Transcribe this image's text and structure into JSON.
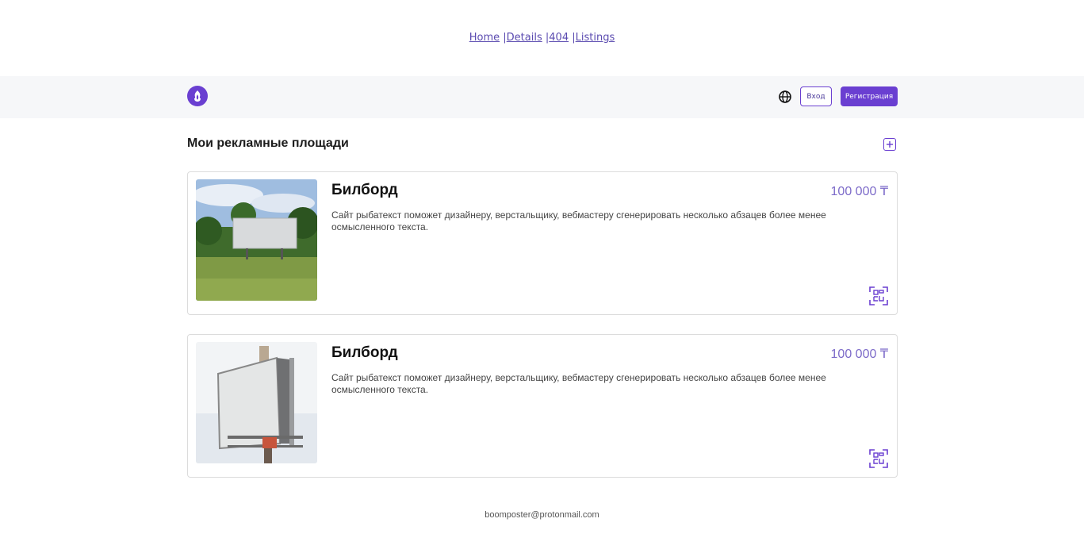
{
  "top_links": {
    "home": "Home",
    "details": "Details",
    "not_found": "404",
    "listings": "Listings",
    "separator": "|"
  },
  "header": {
    "logo_icon": "flame-icon",
    "language_icon": "globe-icon",
    "login_label": "Вход",
    "register_label": "Регистрация",
    "accent_color": "#6a3fd1"
  },
  "page": {
    "title": "Мои рекламные площади",
    "add_icon": "plus-square-icon"
  },
  "listings": [
    {
      "title": "Билборд",
      "price": "100 000 ₸",
      "description": "Сайт рыбатекст поможет дизайнеру, верстальщику, вебмастеру сгенерировать несколько абзацев более менее осмысленного текста.",
      "image": "billboard-in-field",
      "qr_icon": "qr-code-icon"
    },
    {
      "title": "Билборд",
      "price": "100 000 ₸",
      "description": "Сайт рыбатекст поможет дизайнеру, верстальщику, вебмастеру сгенерировать несколько абзацев более менее осмысленного текста.",
      "image": "billboard-angled-sky",
      "qr_icon": "qr-code-icon"
    }
  ],
  "footer": {
    "email": "boomposter@protonmail.com"
  }
}
